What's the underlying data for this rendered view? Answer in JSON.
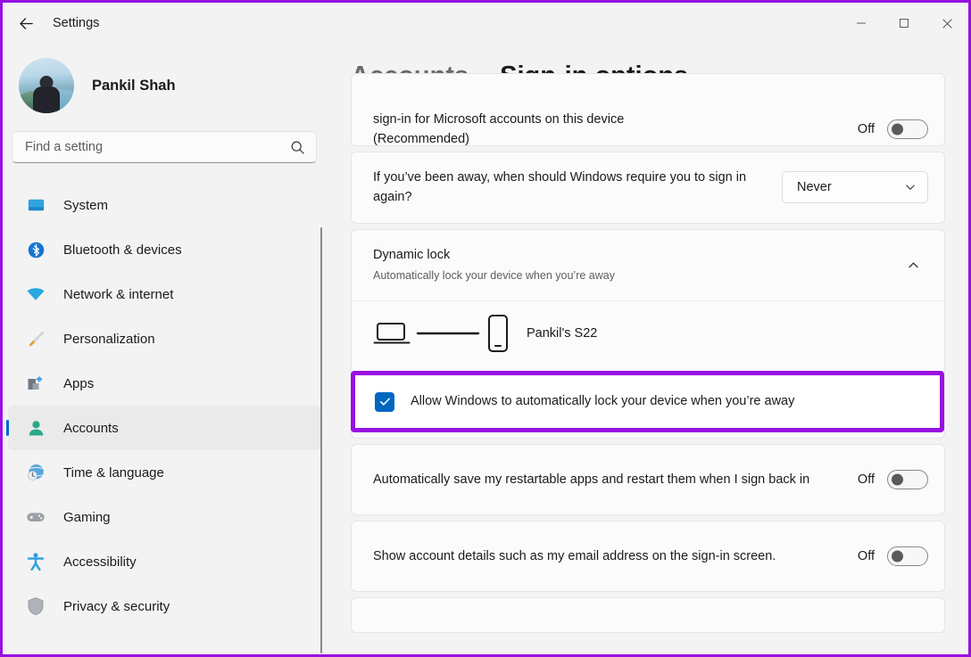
{
  "window": {
    "title": "Settings",
    "back_icon": "arrow-left-icon",
    "minimize_label": "─",
    "maximize_label": "□",
    "close_label": "✕",
    "frame_color": "#9810e0"
  },
  "profile": {
    "name": "Pankil Shah"
  },
  "search": {
    "placeholder": "Find a setting",
    "value": "",
    "icon": "search-icon"
  },
  "sidebar": {
    "items": [
      {
        "label": "System",
        "icon": "monitor-icon",
        "color": "#2b85c9",
        "selected": false
      },
      {
        "label": "Bluetooth & devices",
        "icon": "bluetooth-icon",
        "color": "#1575d1",
        "selected": false
      },
      {
        "label": "Network & internet",
        "icon": "wifi-icon",
        "color": "#2aa8e0",
        "selected": false
      },
      {
        "label": "Personalization",
        "icon": "paintbrush-icon",
        "color": "#e98a2b",
        "selected": false
      },
      {
        "label": "Apps",
        "icon": "apps-icon",
        "color": "#4aa3e8",
        "selected": false
      },
      {
        "label": "Accounts",
        "icon": "person-icon",
        "color": "#2aa88a",
        "selected": true
      },
      {
        "label": "Time & language",
        "icon": "clock-globe-icon",
        "color": "#4f9fd4",
        "selected": false
      },
      {
        "label": "Gaming",
        "icon": "gamepad-icon",
        "color": "#9aa0a6",
        "selected": false
      },
      {
        "label": "Accessibility",
        "icon": "accessibility-icon",
        "color": "#2b9ee0",
        "selected": false
      },
      {
        "label": "Privacy & security",
        "icon": "shield-icon",
        "color": "#9aa0a6",
        "selected": false
      }
    ],
    "accent_color": "#0066cc"
  },
  "breadcrumb": {
    "parent": "Accounts",
    "separator": "›",
    "current": "Sign-in options"
  },
  "cards": {
    "microsoft_signin": {
      "text_line1": "sign-in for Microsoft accounts on this device",
      "text_line2": "(Recommended)",
      "toggle_label": "Off",
      "toggle_state": "off"
    },
    "away_signin": {
      "text": "If you’ve been away, when should Windows require you to sign in again?",
      "dropdown_value": "Never",
      "dropdown_icon": "chevron-down-icon"
    },
    "dynamic_lock": {
      "title": "Dynamic lock",
      "subtitle": "Automatically lock your device when you’re away",
      "expander_icon": "chevron-up-icon",
      "device_name": "Pankil's S22",
      "device_icons": [
        "laptop-icon",
        "link-line-icon",
        "phone-icon"
      ],
      "checkbox_label": "Allow Windows to automatically lock your device when you’re away",
      "checkbox_checked": true,
      "checkbox_color": "#0067c0",
      "highlight_color": "#9810e0"
    },
    "restartable_apps": {
      "text": "Automatically save my restartable apps and restart them when I sign back in",
      "toggle_label": "Off",
      "toggle_state": "off"
    },
    "account_details": {
      "text": "Show account details such as my email address on the sign-in screen.",
      "toggle_label": "Off",
      "toggle_state": "off"
    }
  }
}
